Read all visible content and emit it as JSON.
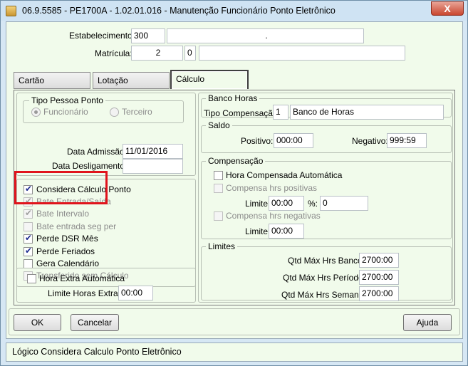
{
  "window": {
    "title": "06.9.5585 - PE1700A - 1.02.01.016 - Manutenção Funcionário Ponto Eletrônico",
    "close_glyph": "X"
  },
  "header": {
    "estabelecimento_label": "Estabelecimento:",
    "estabelecimento_value": "300",
    "estabelecimento_desc": ".",
    "matricula_label": "Matrícula:",
    "matricula_value": "2",
    "matricula_digit": "0",
    "matricula_desc": ""
  },
  "tabs": [
    {
      "label": "Cartão"
    },
    {
      "label": "Lotação"
    },
    {
      "label": "Cálculo"
    }
  ],
  "left": {
    "tipo_pessoa": {
      "title": "Tipo Pessoa Ponto",
      "option1": "Funcionário",
      "option2": "Terceiro"
    },
    "data_admissao_label": "Data Admissão:",
    "data_admissao_value": "11/01/2016",
    "data_desligamento_label": "Data Desligamento:",
    "data_desligamento_value": "",
    "checks": {
      "considera_calculo": "Considera Cálculo Ponto",
      "bate_entrada_saida": "Bate Entrada/Saída",
      "bate_intervalo": "Bate Intervalo",
      "bate_entrada_seg": "Bate entrada seg per",
      "perde_dsr": "Perde DSR Mês",
      "perde_feriados": "Perde Feriados",
      "gera_calendario": "Gera Calendário",
      "transferido": "Transferido sem Cálculo"
    },
    "hora_extra": {
      "label": "Hora Extra Automática",
      "limite_label": "Limite Horas Extras:",
      "limite_value": "00:00"
    }
  },
  "right": {
    "banco_horas": {
      "title": "Banco Horas",
      "tipo_label": "Tipo Compensação:",
      "tipo_value": "1",
      "tipo_desc": "Banco de Horas"
    },
    "saldo": {
      "title": "Saldo",
      "positivo_label": "Positivo:",
      "positivo_value": "000:00",
      "negativo_label": "Negativo:",
      "negativo_value": "999:59"
    },
    "compensacao": {
      "title": "Compensação",
      "hora_compensada": "Hora Compensada Automática",
      "compensa_positivas": "Compensa hrs positivas",
      "limite1_label": "Limite:",
      "limite1_value": "00:00",
      "pct_label": "%:",
      "pct_value": "0",
      "compensa_negativas": "Compensa hrs negativas",
      "limite2_label": "Limite:",
      "limite2_value": "00:00"
    },
    "limites": {
      "title": "Limites",
      "banco_label": "Qtd Máx Hrs Banco:",
      "banco_value": "2700:00",
      "periodo_label": "Qtd Máx Hrs Período:",
      "periodo_value": "2700:00",
      "semana_label": "Qtd Máx Hrs Semana:",
      "semana_value": "2700:00"
    }
  },
  "buttons": {
    "ok": "OK",
    "cancelar": "Cancelar",
    "ajuda": "Ajuda"
  },
  "status": {
    "text": "Lógico Considera Calculo Ponto Eletrônico"
  },
  "colors": {
    "highlight_box": "#e0141c",
    "panel_bg": "#f1fbeb"
  }
}
